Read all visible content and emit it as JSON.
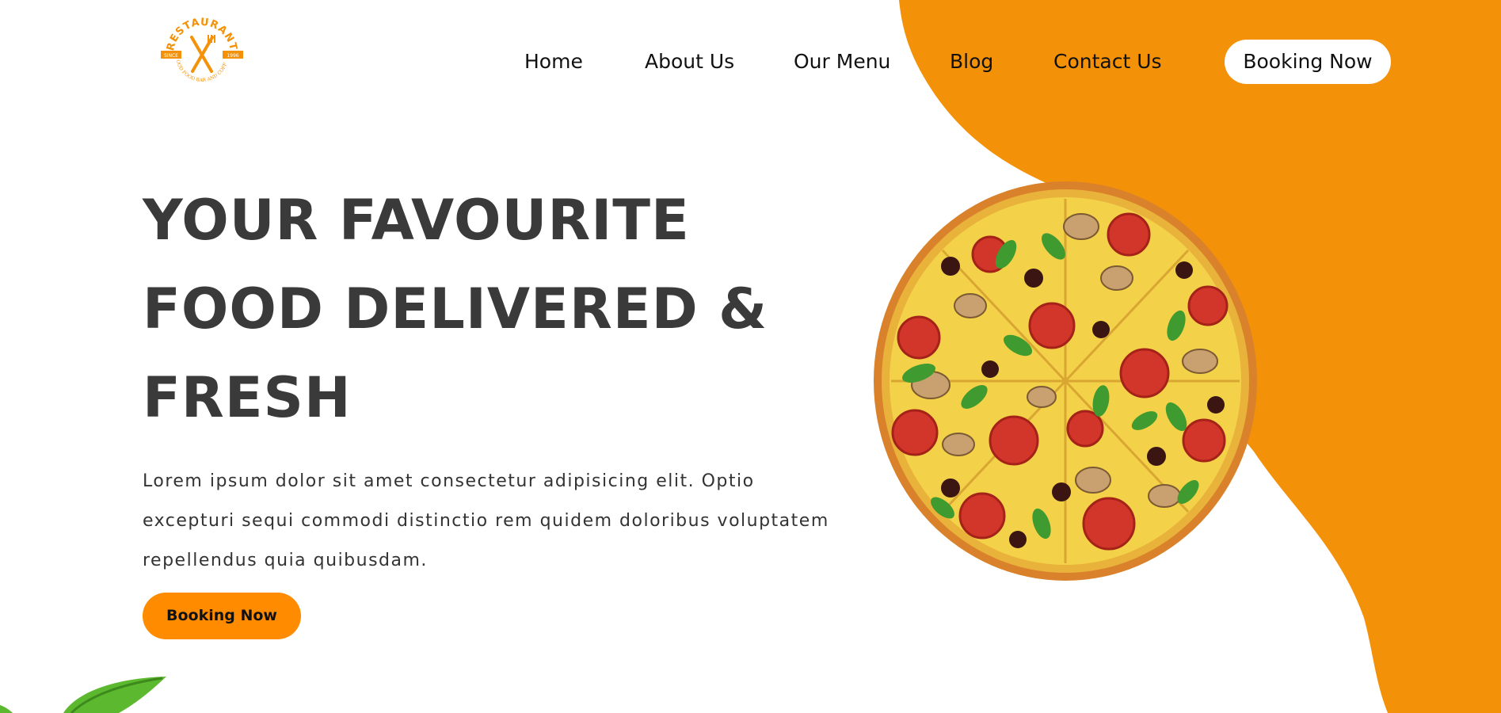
{
  "brand": {
    "logo_text": "RESTAURANT",
    "logo_since": "SINCE",
    "logo_year": "1996",
    "logo_tagline": "GOOD FOOD BAR AND COFFEE",
    "accent_color": "#f39208"
  },
  "nav": {
    "items": [
      {
        "label": "Home"
      },
      {
        "label": "About Us"
      },
      {
        "label": "Our Menu"
      },
      {
        "label": "Blog"
      },
      {
        "label": "Contact Us"
      }
    ],
    "booking_label": "Booking Now"
  },
  "hero": {
    "title_lines": [
      "YOUR FAVOURITE",
      "FOOD DELIVERED &",
      "FRESH"
    ],
    "description_lines": [
      "Lorem ipsum dolor sit amet consectetur adipisicing elit. Optio",
      "excepturi sequi commodi distinctio rem quidem doloribus voluptatem",
      "repellendus quia quibusdam."
    ],
    "booking_label": "Booking Now",
    "image": "pizza-image",
    "decoration": "leaf-image"
  }
}
